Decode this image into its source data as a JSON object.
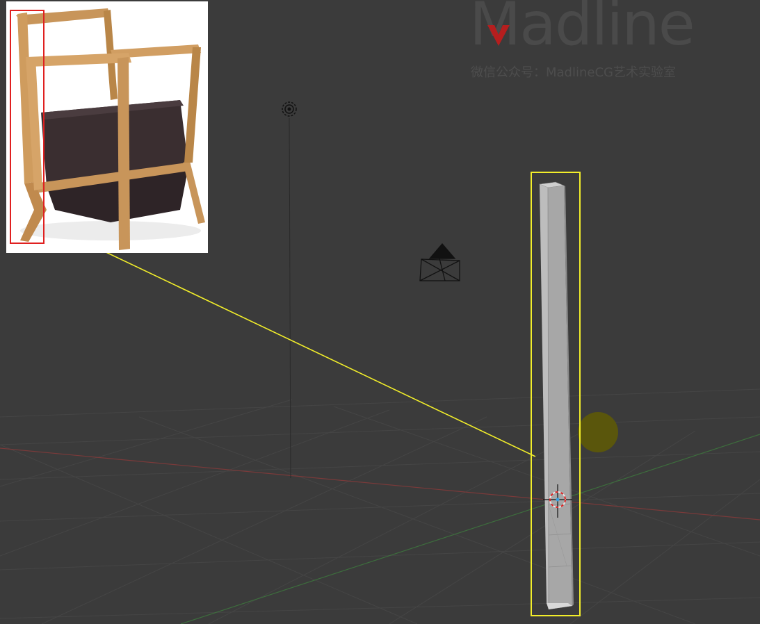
{
  "watermark": {
    "brand": "Madline",
    "subtitle": "微信公众号：MadlineCG艺术实验室"
  },
  "viewport": {
    "objects": [
      "light-icon",
      "camera-icon",
      "sun-icon",
      "chair-leg-post",
      "3d-cursor-icon"
    ]
  },
  "reference": {
    "subject": "wooden armchair with dark fabric cushion"
  },
  "colors": {
    "background": "#3b3b3b",
    "grid": "#454545",
    "x_axis": "#7a3a3a",
    "y_axis": "#3d6e3d",
    "selection": "#f2ee2a",
    "reference_highlight": "#e02020",
    "wood": "#c8955a",
    "cushion": "#3a2e30",
    "post": "#a9a9a9"
  }
}
